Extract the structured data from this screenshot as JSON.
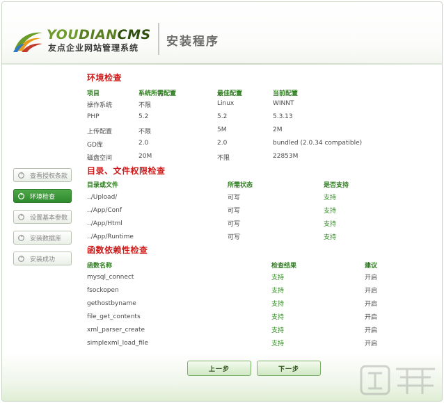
{
  "header": {
    "brand_you": "YOU",
    "brand_dian": "DIAN",
    "brand_cms": "CMS",
    "brand_subtitle": "友点企业网站管理系统",
    "page_title": "安装程序"
  },
  "sidebar": {
    "items": [
      {
        "label": "查看授权条款",
        "active": false
      },
      {
        "label": "环境检查",
        "active": true
      },
      {
        "label": "设置基本参数",
        "active": false
      },
      {
        "label": "安装数据库",
        "active": false
      },
      {
        "label": "安装成功",
        "active": false
      }
    ]
  },
  "env_check": {
    "title": "环境检查",
    "headers": [
      "项目",
      "系统所需配置",
      "最佳配置",
      "当前配置"
    ],
    "rows": [
      [
        "操作系统",
        "不限",
        "Linux",
        "WINNT"
      ],
      [
        "PHP",
        "5.2",
        "5.2",
        "5.3.13"
      ],
      [
        "上传配置",
        "不限",
        "5M",
        "2M"
      ],
      [
        "GD库",
        "2.0",
        "2.0",
        "bundled (2.0.34 compatible)"
      ],
      [
        "磁盘空间",
        "20M",
        "不限",
        "22853M"
      ]
    ]
  },
  "perm_check": {
    "title": "目录、文件权限检查",
    "headers": [
      "目录或文件",
      "所需状态",
      "是否支持"
    ],
    "rows": [
      [
        "../Upload/",
        "可写",
        "支持"
      ],
      [
        "../App/Conf",
        "可写",
        "支持"
      ],
      [
        "../App/Html",
        "可写",
        "支持"
      ],
      [
        "../App/Runtime",
        "可写",
        "支持"
      ]
    ]
  },
  "func_check": {
    "title": "函数依赖性检查",
    "headers": [
      "函数名称",
      "检查结果",
      "建议"
    ],
    "rows": [
      [
        "mysql_connect",
        "支持",
        "开启"
      ],
      [
        "fsockopen",
        "支持",
        "开启"
      ],
      [
        "gethostbyname",
        "支持",
        "开启"
      ],
      [
        "file_get_contents",
        "支持",
        "开启"
      ],
      [
        "xml_parser_create",
        "支持",
        "开启"
      ],
      [
        "simplexml_load_file",
        "支持",
        "开启"
      ]
    ]
  },
  "footer": {
    "prev_label": "上一步",
    "next_label": "下一步"
  },
  "colors": {
    "section_title": "#d01a1a",
    "header_green": "#2e7d1f",
    "active_green": "#3a9a36"
  }
}
